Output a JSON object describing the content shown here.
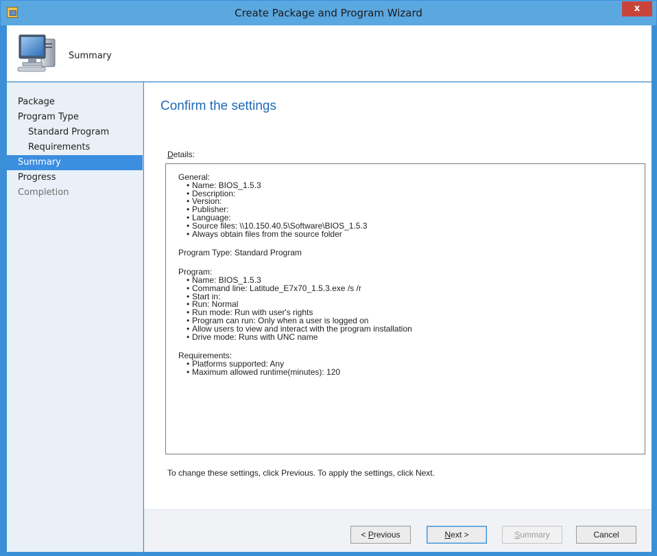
{
  "window": {
    "title": "Create Package and Program Wizard",
    "close_label": "x"
  },
  "header": {
    "title": "Summary",
    "icon": "computer-icon"
  },
  "nav": {
    "items": [
      {
        "label": "Package",
        "level": 0,
        "state": "normal"
      },
      {
        "label": "Program Type",
        "level": 0,
        "state": "normal"
      },
      {
        "label": "Standard Program",
        "level": 1,
        "state": "normal"
      },
      {
        "label": "Requirements",
        "level": 1,
        "state": "normal"
      },
      {
        "label": "Summary",
        "level": 0,
        "state": "active"
      },
      {
        "label": "Progress",
        "level": 0,
        "state": "normal"
      },
      {
        "label": "Completion",
        "level": 0,
        "state": "disabled"
      }
    ]
  },
  "main": {
    "heading": "Confirm the settings",
    "details_label_acc": "D",
    "details_label_rest": "etails:",
    "details": {
      "general_head": "General:",
      "general_items": [
        "Name: BIOS_1.5.3",
        "Description:",
        "Version:",
        "Publisher:",
        "Language:",
        "Source files: \\\\10.150.40.5\\Software\\BIOS_1.5.3",
        "Always obtain files from the source folder"
      ],
      "program_type": "Program Type: Standard Program",
      "program_head": "Program:",
      "program_items": [
        "Name: BIOS_1.5.3",
        "Command line: Latitude_E7x70_1.5.3.exe /s /r",
        "Start in:",
        "Run: Normal",
        "Run mode: Run with user's rights",
        "Program can run: Only when a user is logged on",
        "Allow users to view and interact with the program installation",
        "Drive mode: Runs with UNC name"
      ],
      "requirements_head": "Requirements:",
      "requirements_items": [
        "Platforms supported: Any",
        "Maximum allowed runtime(minutes): 120"
      ]
    },
    "instruction": "To change these settings, click Previous. To apply the settings, click Next."
  },
  "buttons": {
    "previous_prefix": "< ",
    "previous_acc": "P",
    "previous_rest": "revious",
    "next_acc": "N",
    "next_rest": "ext >",
    "summary_acc": "S",
    "summary_rest": "ummary",
    "cancel": "Cancel"
  },
  "colors": {
    "accent": "#3b8ee0",
    "heading": "#1f6ab4",
    "window_border": "#3a8fd6"
  }
}
